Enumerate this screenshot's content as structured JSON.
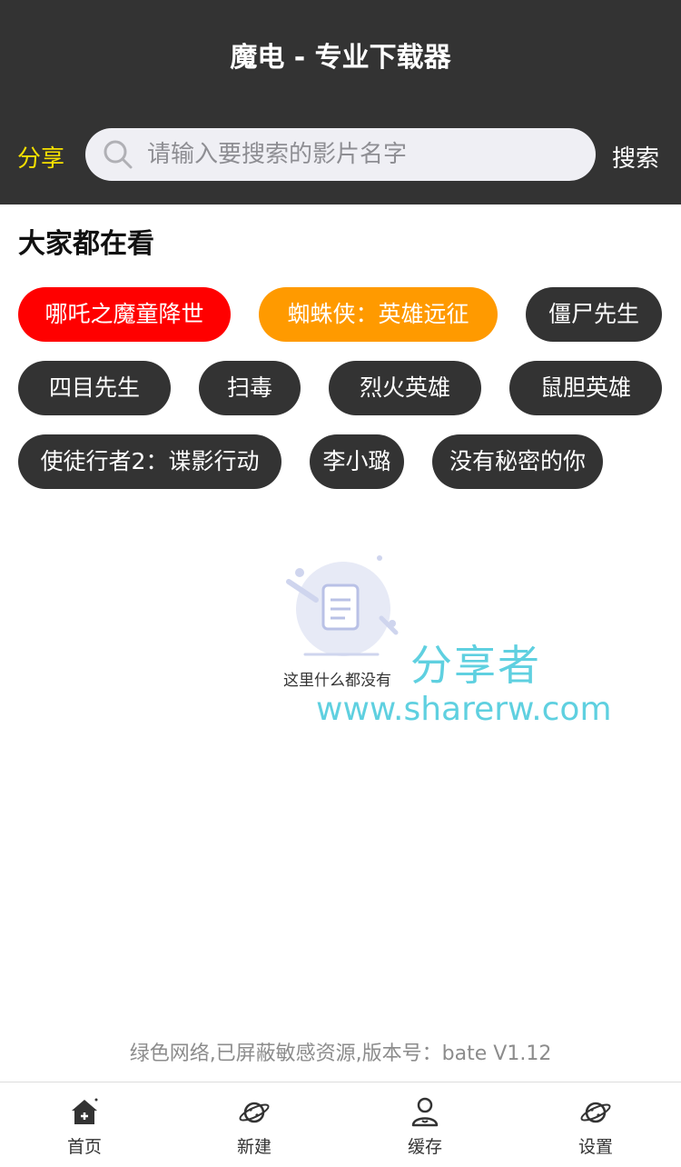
{
  "header": {
    "title": "魔电 - 专业下载器",
    "share_label": "分享",
    "search_placeholder": "请输入要搜索的影片名字",
    "search_button": "搜索"
  },
  "section": {
    "title": "大家都在看"
  },
  "tags": [
    {
      "label": "哪吒之魔童降世",
      "color": "#ff0000"
    },
    {
      "label": "蜘蛛侠：英雄远征",
      "color": "#ff9a00"
    },
    {
      "label": "僵尸先生",
      "color": "#333333"
    },
    {
      "label": "四目先生",
      "color": "#333333"
    },
    {
      "label": "扫毒",
      "color": "#333333"
    },
    {
      "label": "烈火英雄",
      "color": "#333333"
    },
    {
      "label": "鼠胆英雄",
      "color": "#333333"
    },
    {
      "label": "使徒行者2：谍影行动",
      "color": "#333333"
    },
    {
      "label": "李小璐",
      "color": "#333333"
    },
    {
      "label": "没有秘密的你",
      "color": "#333333"
    }
  ],
  "empty_state": {
    "text": "这里什么都没有",
    "icon": "empty-document-icon"
  },
  "watermark": {
    "name": "分享者",
    "url": "www.sharerw.com"
  },
  "footer_note": "绿色网络,已屏蔽敏感资源,版本号：bate V1.12",
  "tabbar": {
    "items": [
      {
        "label": "首页",
        "icon": "home-icon"
      },
      {
        "label": "新建",
        "icon": "planet-icon"
      },
      {
        "label": "缓存",
        "icon": "user-icon"
      },
      {
        "label": "设置",
        "icon": "planet-icon"
      }
    ]
  }
}
